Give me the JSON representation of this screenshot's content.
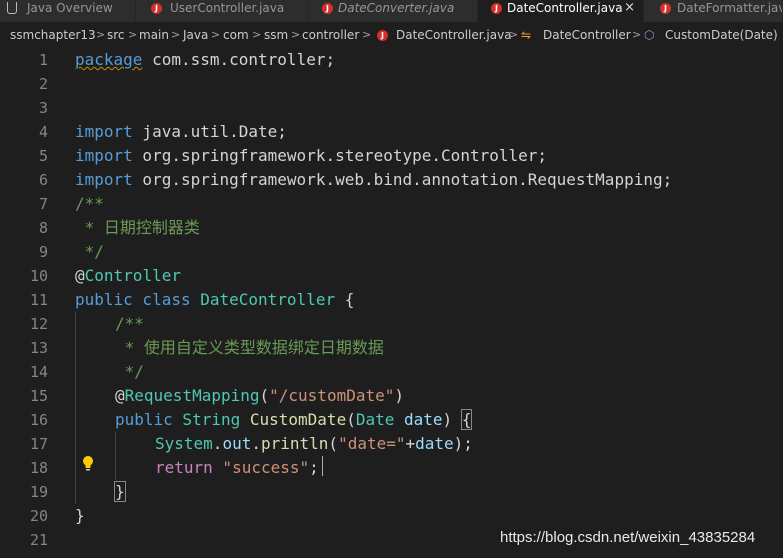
{
  "tabs": [
    {
      "label": "Java Overview",
      "icon": "java-overview-icon",
      "italic": false,
      "active": false
    },
    {
      "label": "UserController.java",
      "icon": "java-file-icon",
      "italic": false,
      "active": false
    },
    {
      "label": "DateConverter.java",
      "icon": "java-file-icon",
      "italic": true,
      "active": false
    },
    {
      "label": "DateController.java",
      "icon": "java-file-icon",
      "italic": false,
      "active": true,
      "close": "×"
    },
    {
      "label": "DateFormatter.java",
      "icon": "java-file-icon",
      "italic": false,
      "active": false
    }
  ],
  "breadcrumb": [
    "ssmchapter13",
    "src",
    "main",
    "Java",
    "com",
    "ssm",
    "controller",
    "DateController.java",
    "DateController",
    "CustomDate(Date)"
  ],
  "breadcrumb_sep": ">",
  "code": {
    "line_numbers": [
      "1",
      "2",
      "3",
      "4",
      "5",
      "6",
      "7",
      "8",
      "9",
      "10",
      "11",
      "12",
      "13",
      "14",
      "15",
      "16",
      "17",
      "18",
      "19",
      "20",
      "21"
    ],
    "l1": {
      "kw": "package",
      "rest": " com.ssm.controller;"
    },
    "l4": {
      "kw": "import",
      "rest": " java.util.Date;"
    },
    "l5": {
      "kw": "import",
      "rest": " org.springframework.stereotype.Controller;"
    },
    "l6": {
      "kw": "import",
      "rest": " org.springframework.web.bind.annotation.RequestMapping;"
    },
    "l7": "/**",
    "l8": " * 日期控制器类",
    "l9": " */",
    "l10": {
      "at": "@",
      "ann": "Controller"
    },
    "l11": {
      "kw1": "public",
      "kw2": " class",
      "cls": " DateController",
      "brace": " {"
    },
    "l12": "/**",
    "l13": " * 使用自定义类型数据绑定日期数据",
    "l14": " */",
    "l15": {
      "at": "@",
      "ann": "RequestMapping",
      "open": "(",
      "str": "\"/customDate\"",
      "close": ")"
    },
    "l16": {
      "kw": "public",
      "type": " String",
      "fn": " CustomDate",
      "open": "(",
      "ptype": "Date",
      "pname": " date",
      "close": ") ",
      "brace": "{"
    },
    "l17": {
      "cls": "System",
      "dot1": ".",
      "field": "out",
      "dot2": ".",
      "fn": "println",
      "open": "(",
      "str": "\"date=\"",
      "plus": "+",
      "var": "date",
      "close": ");"
    },
    "l18": {
      "kw": "return",
      "str": " \"success\"",
      "semi": ";"
    },
    "l19": "}",
    "l20": "}"
  },
  "watermark": "https://blog.csdn.net/weixin_43835284",
  "colors": {
    "keyword": "#569cd6",
    "control": "#c586c0",
    "comment": "#6a9955",
    "class": "#4ec9b0",
    "function": "#dcdcaa",
    "string": "#ce9178",
    "variable": "#9cdcfe"
  }
}
